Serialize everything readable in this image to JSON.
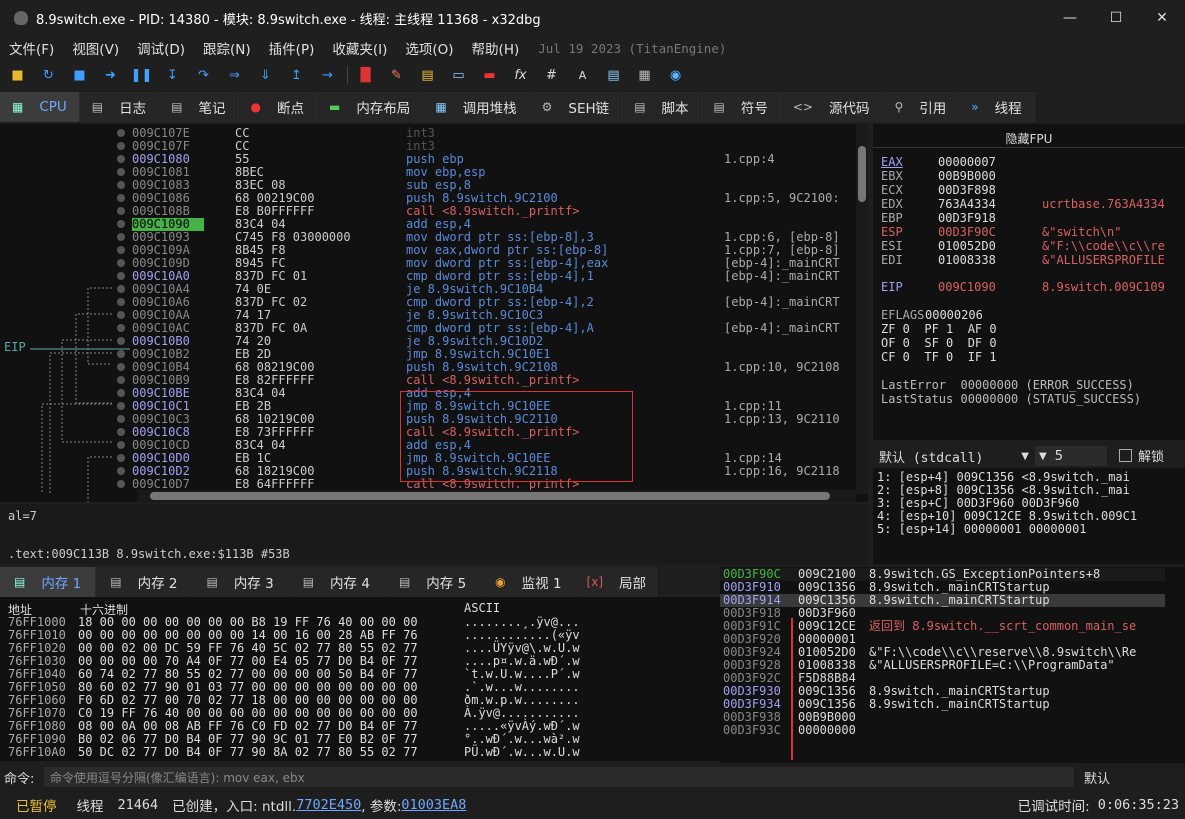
{
  "window": {
    "title": "8.9switch.exe - PID: 14380 - 模块: 8.9switch.exe - 线程: 主线程 11368 - x32dbg"
  },
  "menu": {
    "items": [
      "文件(F)",
      "视图(V)",
      "调试(D)",
      "跟踪(N)",
      "插件(P)",
      "收藏夹(I)",
      "选项(O)",
      "帮助(H)"
    ],
    "build_info": "Jul 19 2023 (TitanEngine)"
  },
  "tabs": [
    {
      "label": "CPU",
      "icon": "cpu-icon"
    },
    {
      "label": "日志",
      "icon": "log-icon"
    },
    {
      "label": "笔记",
      "icon": "notes-icon"
    },
    {
      "label": "断点",
      "icon": "breakpoint-icon"
    },
    {
      "label": "内存布局",
      "icon": "memory-map-icon"
    },
    {
      "label": "调用堆栈",
      "icon": "callstack-icon"
    },
    {
      "label": "SEH链",
      "icon": "seh-icon"
    },
    {
      "label": "脚本",
      "icon": "script-icon"
    },
    {
      "label": "符号",
      "icon": "symbol-icon"
    },
    {
      "label": "源代码",
      "icon": "source-icon"
    },
    {
      "label": "引用",
      "icon": "references-icon"
    },
    {
      "label": "线程",
      "icon": "threads-icon"
    }
  ],
  "disasm": {
    "eip_label": "EIP",
    "rows": [
      {
        "addr": "009C107E",
        "bytes": "CC",
        "ins": "int3",
        "cmt": ""
      },
      {
        "addr": "009C107F",
        "bytes": "CC",
        "ins": "int3",
        "cmt": ""
      },
      {
        "addr": "009C1080",
        "bytes": "55",
        "ins": "push ebp",
        "cmt": "1.cpp:4"
      },
      {
        "addr": "009C1081",
        "bytes": "8BEC",
        "ins": "mov ebp,esp",
        "cmt": ""
      },
      {
        "addr": "009C1083",
        "bytes": "83EC 08",
        "ins": "sub esp,8",
        "cmt": ""
      },
      {
        "addr": "009C1086",
        "bytes": "68 00219C00",
        "ins": "push 8.9switch.9C2100",
        "cmt": "1.cpp:5, 9C2100:"
      },
      {
        "addr": "009C108B",
        "bytes": "E8 B0FFFFFF",
        "ins": "call <8.9switch._printf>",
        "cmt": ""
      },
      {
        "addr": "009C1090",
        "bytes": "83C4 04",
        "ins": "add esp,4",
        "cmt": ""
      },
      {
        "addr": "009C1093",
        "bytes": "C745 F8 03000000",
        "ins": "mov dword ptr ss:[ebp-8],3",
        "cmt": "1.cpp:6, [ebp-8]"
      },
      {
        "addr": "009C109A",
        "bytes": "8B45 F8",
        "ins": "mov eax,dword ptr ss:[ebp-8]",
        "cmt": "1.cpp:7, [ebp-8]"
      },
      {
        "addr": "009C109D",
        "bytes": "8945 FC",
        "ins": "mov dword ptr ss:[ebp-4],eax",
        "cmt": "[ebp-4]:_mainCRT"
      },
      {
        "addr": "009C10A0",
        "bytes": "837D FC 01",
        "ins": "cmp dword ptr ss:[ebp-4],1",
        "cmt": "[ebp-4]:_mainCRT"
      },
      {
        "addr": "009C10A4",
        "bytes": "74 0E",
        "ins": "je 8.9switch.9C10B4",
        "cmt": ""
      },
      {
        "addr": "009C10A6",
        "bytes": "837D FC 02",
        "ins": "cmp dword ptr ss:[ebp-4],2",
        "cmt": "[ebp-4]:_mainCRT"
      },
      {
        "addr": "009C10AA",
        "bytes": "74 17",
        "ins": "je 8.9switch.9C10C3",
        "cmt": ""
      },
      {
        "addr": "009C10AC",
        "bytes": "837D FC 0A",
        "ins": "cmp dword ptr ss:[ebp-4],A",
        "cmt": "[ebp-4]:_mainCRT"
      },
      {
        "addr": "009C10B0",
        "bytes": "74 20",
        "ins": "je 8.9switch.9C10D2",
        "cmt": ""
      },
      {
        "addr": "009C10B2",
        "bytes": "EB 2D",
        "ins": "jmp 8.9switch.9C10E1",
        "cmt": ""
      },
      {
        "addr": "009C10B4",
        "bytes": "68 08219C00",
        "ins": "push 8.9switch.9C2108",
        "cmt": "1.cpp:10, 9C2108"
      },
      {
        "addr": "009C10B9",
        "bytes": "E8 82FFFFFF",
        "ins": "call <8.9switch._printf>",
        "cmt": ""
      },
      {
        "addr": "009C10BE",
        "bytes": "83C4 04",
        "ins": "add esp,4",
        "cmt": ""
      },
      {
        "addr": "009C10C1",
        "bytes": "EB 2B",
        "ins": "jmp 8.9switch.9C10EE",
        "cmt": "1.cpp:11"
      },
      {
        "addr": "009C10C3",
        "bytes": "68 10219C00",
        "ins": "push 8.9switch.9C2110",
        "cmt": "1.cpp:13, 9C2110"
      },
      {
        "addr": "009C10C8",
        "bytes": "E8 73FFFFFF",
        "ins": "call <8.9switch._printf>",
        "cmt": ""
      },
      {
        "addr": "009C10CD",
        "bytes": "83C4 04",
        "ins": "add esp,4",
        "cmt": ""
      },
      {
        "addr": "009C10D0",
        "bytes": "EB 1C",
        "ins": "jmp 8.9switch.9C10EE",
        "cmt": "1.cpp:14"
      },
      {
        "addr": "009C10D2",
        "bytes": "68 18219C00",
        "ins": "push 8.9switch.9C2118",
        "cmt": "1.cpp:16, 9C2118"
      },
      {
        "addr": "009C10D7",
        "bytes": "E8 64FFFFFF",
        "ins": "call <8.9switch._printf>",
        "cmt": ""
      }
    ]
  },
  "info": {
    "line1": "al=7",
    "line2": ".text:009C113B 8.9switch.exe:$113B #53B"
  },
  "registers": {
    "header": "隐藏FPU",
    "gp": [
      {
        "n": "EAX",
        "v": "00000007",
        "c": ""
      },
      {
        "n": "EBX",
        "v": "00B9B000",
        "c": ""
      },
      {
        "n": "ECX",
        "v": "00D3F898",
        "c": ""
      },
      {
        "n": "EDX",
        "v": "763A4334",
        "c": "ucrtbase.763A4334"
      },
      {
        "n": "EBP",
        "v": "00D3F918",
        "c": ""
      },
      {
        "n": "ESP",
        "v": "00D3F90C",
        "c": "&\"switch\\n\""
      },
      {
        "n": "ESI",
        "v": "010052D0",
        "c": "&\"F:\\\\code\\\\c\\\\re"
      },
      {
        "n": "EDI",
        "v": "01008338",
        "c": "&\"ALLUSERSPROFILE"
      }
    ],
    "eip": {
      "n": "EIP",
      "v": "009C1090",
      "c": "8.9switch.009C109"
    },
    "eflags": {
      "n": "EFLAGS",
      "v": "00000206"
    },
    "flags_rows": [
      "ZF 0  PF 1  AF 0",
      "OF 0  SF 0  DF 0",
      "CF 0  TF 0  IF 1"
    ],
    "lasterror": "LastError  00000000 (ERROR_SUCCESS)",
    "laststatus": "LastStatus 00000000 (STATUS_SUCCESS)"
  },
  "callconv": {
    "value": "默认 (stdcall)",
    "count": "5",
    "unlock": "解锁"
  },
  "stackargs": [
    "1: [esp+4] 009C1356 <8.9switch._mai",
    "2: [esp+8] 009C1356 <8.9switch._mai",
    "3: [esp+C] 00D3F960 00D3F960",
    "4: [esp+10] 009C12CE 8.9switch.009C1",
    "5: [esp+14] 00000001 00000001"
  ],
  "bottom_tabs": [
    {
      "label": "内存 1"
    },
    {
      "label": "内存 2"
    },
    {
      "label": "内存 3"
    },
    {
      "label": "内存 4"
    },
    {
      "label": "内存 5"
    },
    {
      "label": "监视 1"
    },
    {
      "label": "局部"
    }
  ],
  "dump": {
    "headers": {
      "addr": "地址",
      "hex": "十六进制",
      "ascii": "ASCII"
    },
    "rows": [
      {
        "a": "76FF1000",
        "h": "18 00 00 00 00 00 00 00 B8 19 FF 76 40 00 00 00",
        "s": "........¸.ÿv@..."
      },
      {
        "a": "76FF1010",
        "h": "00 00 00 00 00 00 00 00 14 00 16 00 28 AB FF 76",
        "s": "............(«ÿv"
      },
      {
        "a": "76FF1020",
        "h": "00 00 02 00 DC 59 FF 76 40 5C 02 77 80 55 02 77",
        "s": "....ÜYÿv@\\.w.U.w"
      },
      {
        "a": "76FF1030",
        "h": "00 00 00 00 70 A4 0F 77 00 E4 05 77 D0 B4 0F 77",
        "s": "....p¤.w.ä.wÐ´.w"
      },
      {
        "a": "76FF1040",
        "h": "60 74 02 77 80 55 02 77 00 00 00 00 50 B4 0F 77",
        "s": "`t.w.U.w....P´.w"
      },
      {
        "a": "76FF1050",
        "h": "80 60 02 77 90 01 03 77 00 00 00 00 00 00 00 00",
        "s": ".`.w...w........"
      },
      {
        "a": "76FF1060",
        "h": "F0 6D 02 77 00 70 02 77 18 00 00 00 00 00 00 00",
        "s": "ðm.w.p.w........"
      },
      {
        "a": "76FF1070",
        "h": "C0 19 FF 76 40 00 00 00 00 00 00 00 00 00 00 00",
        "s": "À.ÿv@..........."
      },
      {
        "a": "76FF1080",
        "h": "08 00 0A 00 08 AB FF 76 C0 FD 02 77 D0 B4 0F 77",
        "s": ".....«ÿvÀý.wÐ´.w"
      },
      {
        "a": "76FF1090",
        "h": "B0 02 06 77 D0 B4 0F 77 90 9C 01 77 E0 B2 0F 77",
        "s": "°..wÐ´.w...wà².w"
      },
      {
        "a": "76FF10A0",
        "h": "50 DC 02 77 D0 B4 0F 77 90 8A 02 77 80 55 02 77",
        "s": "PÜ.wÐ´.w...w.U.w"
      }
    ]
  },
  "stack": {
    "rows": [
      {
        "a": "00D3F90C",
        "v": "009C2100",
        "c": "8.9switch.GS_ExceptionPointers+8"
      },
      {
        "a": "00D3F910",
        "v": "009C1356",
        "c": "8.9switch._mainCRTStartup"
      },
      {
        "a": "00D3F914",
        "v": "009C1356",
        "c": "8.9switch._mainCRTStartup"
      },
      {
        "a": "00D3F918",
        "v": "00D3F960",
        "c": ""
      },
      {
        "a": "00D3F91C",
        "v": "009C12CE",
        "c": "返回到 8.9switch.__scrt_common_main_se"
      },
      {
        "a": "00D3F920",
        "v": "00000001",
        "c": ""
      },
      {
        "a": "00D3F924",
        "v": "010052D0",
        "c": "&\"F:\\\\code\\\\c\\\\reserve\\\\8.9switch\\\\Re"
      },
      {
        "a": "00D3F928",
        "v": "01008338",
        "c": "&\"ALLUSERSPROFILE=C:\\\\ProgramData\""
      },
      {
        "a": "00D3F92C",
        "v": "F5D88B84",
        "c": ""
      },
      {
        "a": "00D3F930",
        "v": "009C1356",
        "c": "8.9switch._mainCRTStartup"
      },
      {
        "a": "00D3F934",
        "v": "009C1356",
        "c": "8.9switch._mainCRTStartup"
      },
      {
        "a": "00D3F938",
        "v": "00B9B000",
        "c": ""
      },
      {
        "a": "00D3F93C",
        "v": "00000000",
        "c": ""
      }
    ]
  },
  "command": {
    "label": "命令:",
    "placeholder": "命令使用逗号分隔(像汇编语言): mov eax, ebx",
    "right": "默认"
  },
  "status": {
    "state": "已暂停",
    "thread_label": "线程",
    "thread_id": "21464",
    "created": "已创建，入口: ntdll.",
    "entry": "7702E450",
    "param_label": ", 参数:",
    "param": "01003EA8",
    "time_label": "已调试时间:",
    "time": "0:06:35:23"
  },
  "colors": {
    "eip_bg": "#44b244",
    "accent": "#6ea8ff",
    "call": "#d86060",
    "highlight_box": "#d33333"
  }
}
